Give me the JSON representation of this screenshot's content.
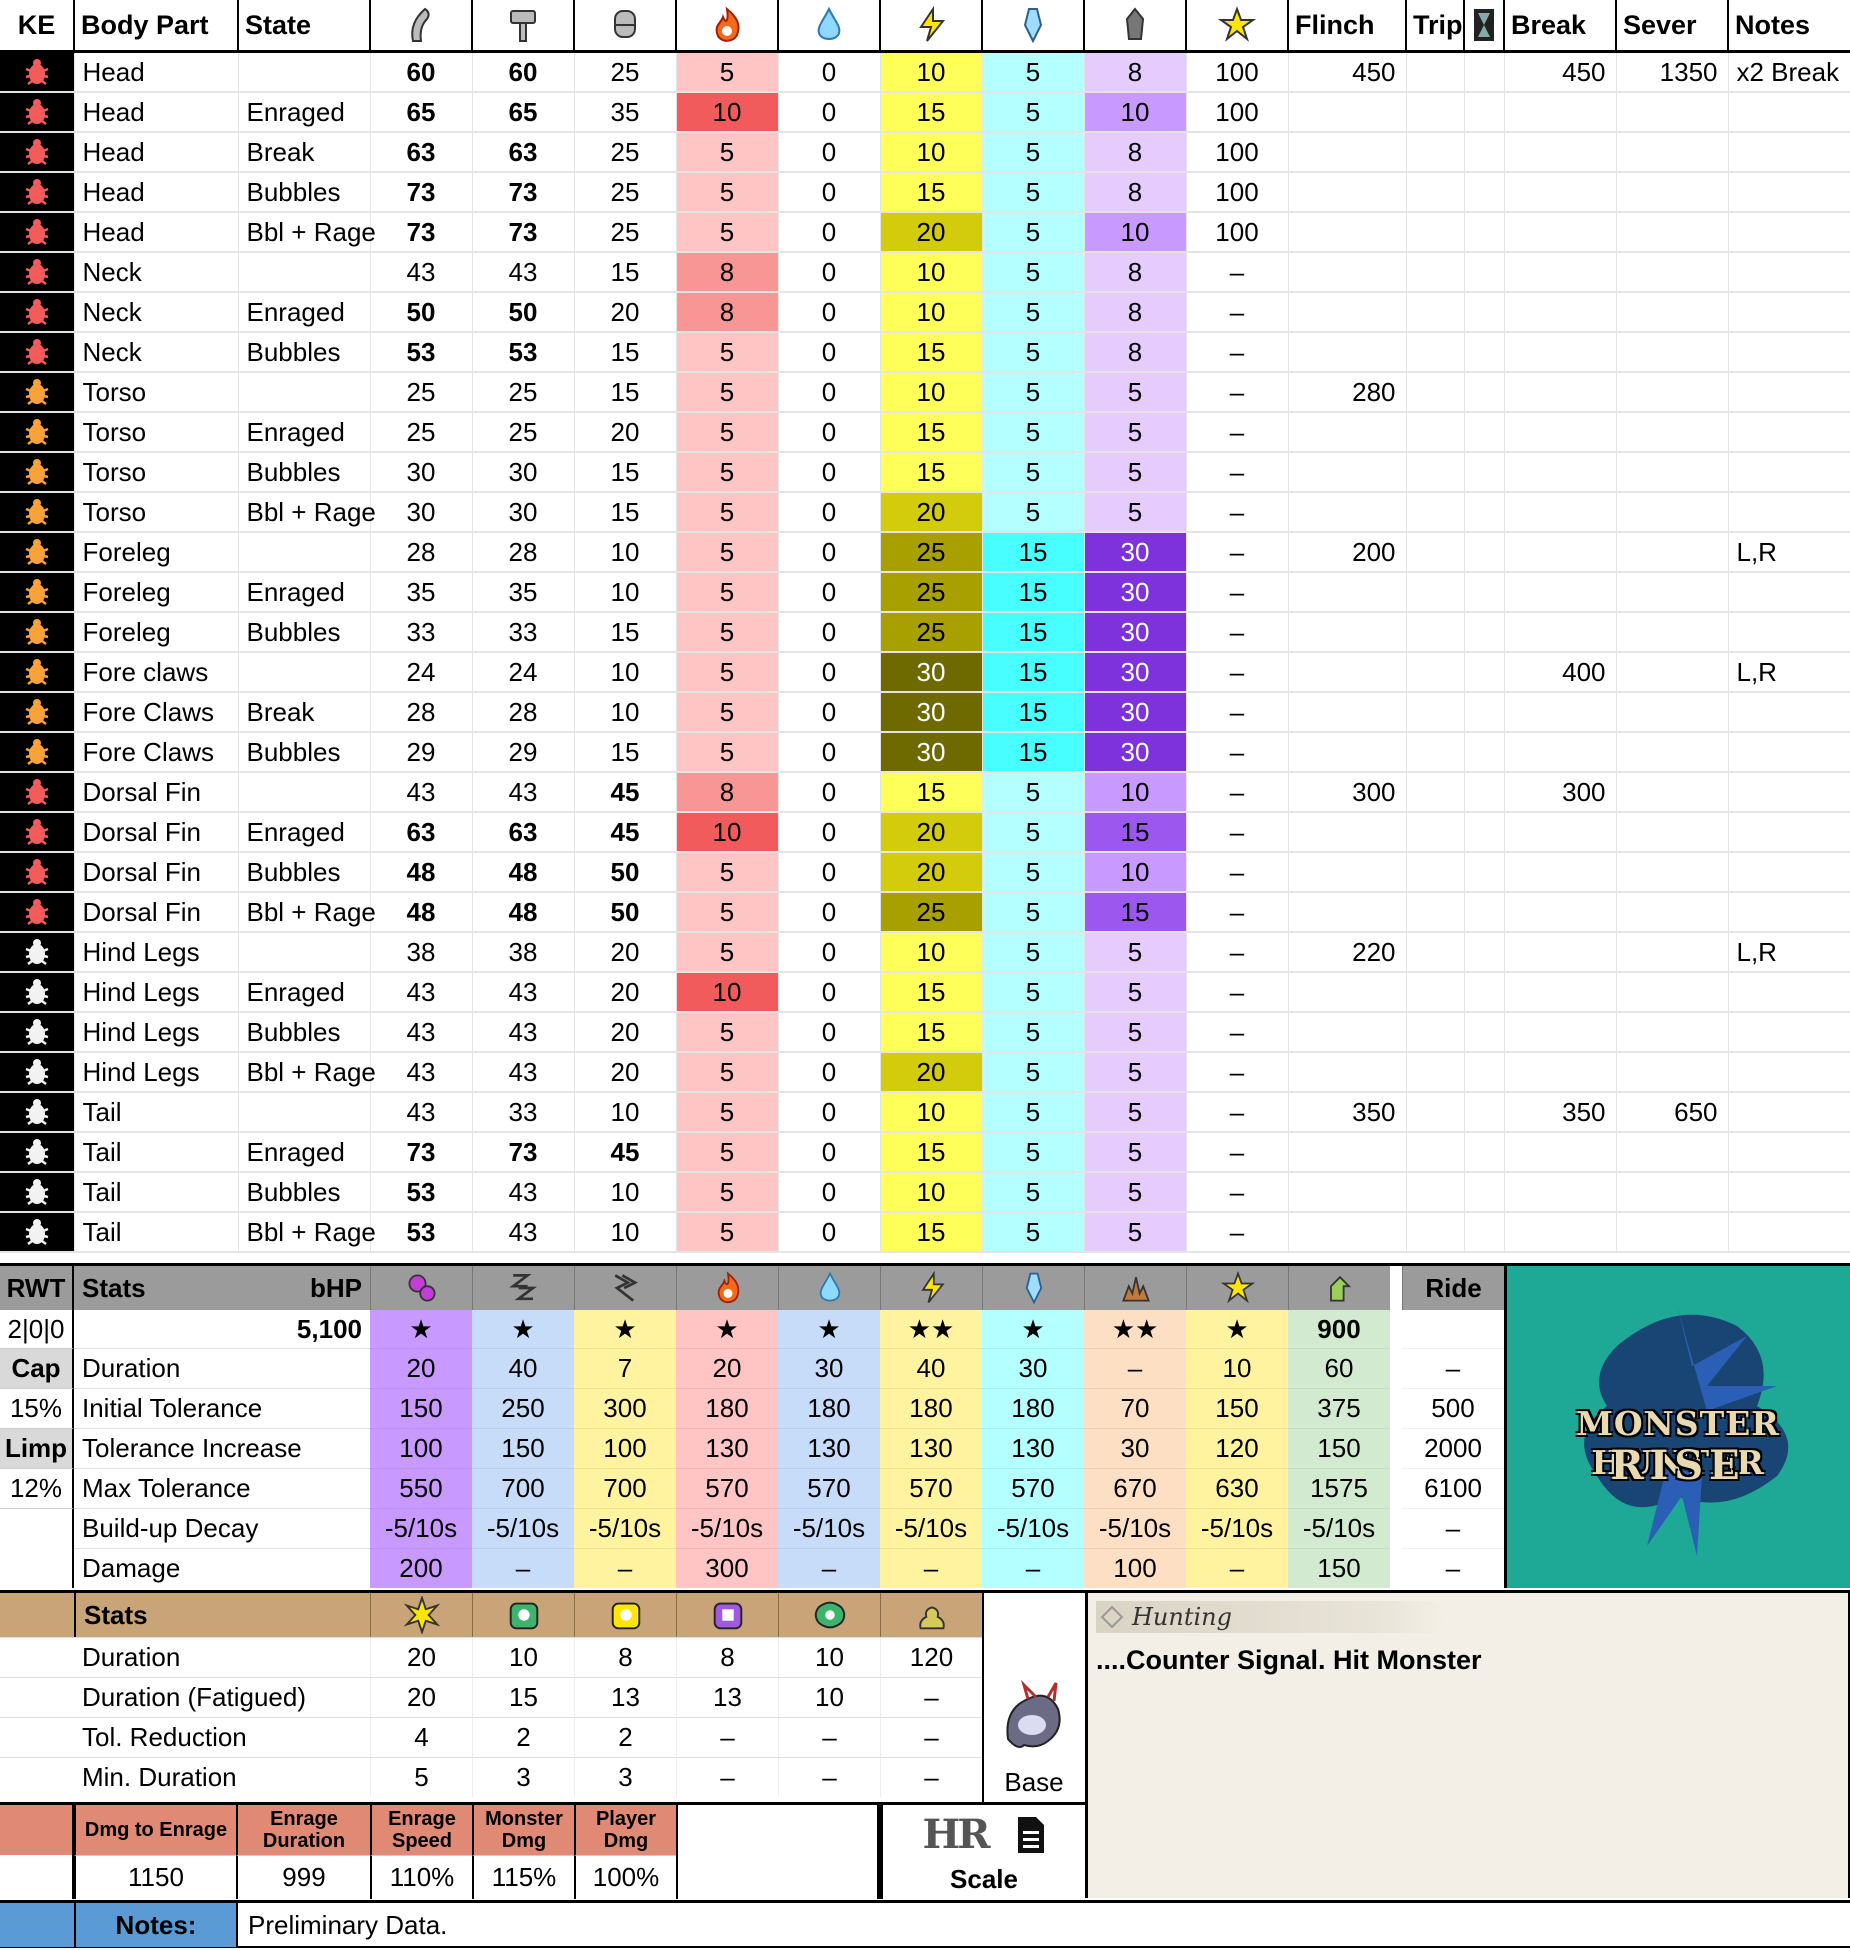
{
  "hitzone": {
    "headers": {
      "ke": "KE",
      "part": "Body Part",
      "state": "State",
      "flinch": "Flinch",
      "trip": "Trip",
      "break": "Break",
      "sever": "Sever",
      "notes": "Notes"
    },
    "icon_names": [
      "cut-icon",
      "blunt-icon",
      "shot-icon",
      "fire-icon",
      "water-icon",
      "thunder-icon",
      "ice-icon",
      "dragon-icon",
      "stun-icon"
    ],
    "rows": [
      {
        "ke": "red",
        "part": "Head",
        "state": "",
        "v": [
          60,
          60,
          25,
          5,
          0,
          10,
          5,
          8,
          "100"
        ],
        "bold": [
          1,
          1,
          0
        ],
        "flinch": "450",
        "trip": "",
        "break": "450",
        "sever": "1350",
        "notes": "x2 Break"
      },
      {
        "ke": "red",
        "part": "Head",
        "state": "Enraged",
        "v": [
          65,
          65,
          35,
          10,
          0,
          15,
          5,
          10,
          "100"
        ],
        "bold": [
          1,
          1,
          0
        ],
        "flinch": "",
        "trip": "",
        "break": "",
        "sever": "",
        "notes": ""
      },
      {
        "ke": "red",
        "part": "Head",
        "state": "Break",
        "v": [
          63,
          63,
          25,
          5,
          0,
          10,
          5,
          8,
          "100"
        ],
        "bold": [
          1,
          1,
          0
        ],
        "flinch": "",
        "trip": "",
        "break": "",
        "sever": "",
        "notes": ""
      },
      {
        "ke": "red",
        "part": "Head",
        "state": "Bubbles",
        "v": [
          73,
          73,
          25,
          5,
          0,
          15,
          5,
          8,
          "100"
        ],
        "bold": [
          1,
          1,
          0
        ],
        "flinch": "",
        "trip": "",
        "break": "",
        "sever": "",
        "notes": ""
      },
      {
        "ke": "red",
        "part": "Head",
        "state": "Bbl + Rage",
        "v": [
          73,
          73,
          25,
          5,
          0,
          20,
          5,
          10,
          "100"
        ],
        "bold": [
          1,
          1,
          0
        ],
        "flinch": "",
        "trip": "",
        "break": "",
        "sever": "",
        "notes": ""
      },
      {
        "ke": "red",
        "part": "Neck",
        "state": "",
        "v": [
          43,
          43,
          15,
          8,
          0,
          10,
          5,
          8,
          "–"
        ],
        "bold": [
          0,
          0,
          0
        ],
        "flinch": "",
        "trip": "",
        "break": "",
        "sever": "",
        "notes": ""
      },
      {
        "ke": "red",
        "part": "Neck",
        "state": "Enraged",
        "v": [
          50,
          50,
          20,
          8,
          0,
          10,
          5,
          8,
          "–"
        ],
        "bold": [
          1,
          1,
          0
        ],
        "flinch": "",
        "trip": "",
        "break": "",
        "sever": "",
        "notes": ""
      },
      {
        "ke": "red",
        "part": "Neck",
        "state": "Bubbles",
        "v": [
          53,
          53,
          15,
          5,
          0,
          15,
          5,
          8,
          "–"
        ],
        "bold": [
          1,
          1,
          0
        ],
        "flinch": "",
        "trip": "",
        "break": "",
        "sever": "",
        "notes": ""
      },
      {
        "ke": "orange",
        "part": "Torso",
        "state": "",
        "v": [
          25,
          25,
          15,
          5,
          0,
          10,
          5,
          5,
          "–"
        ],
        "bold": [
          0,
          0,
          0
        ],
        "flinch": "280",
        "trip": "",
        "break": "",
        "sever": "",
        "notes": ""
      },
      {
        "ke": "orange",
        "part": "Torso",
        "state": "Enraged",
        "v": [
          25,
          25,
          20,
          5,
          0,
          15,
          5,
          5,
          "–"
        ],
        "bold": [
          0,
          0,
          0
        ],
        "flinch": "",
        "trip": "",
        "break": "",
        "sever": "",
        "notes": ""
      },
      {
        "ke": "orange",
        "part": "Torso",
        "state": "Bubbles",
        "v": [
          30,
          30,
          15,
          5,
          0,
          15,
          5,
          5,
          "–"
        ],
        "bold": [
          0,
          0,
          0
        ],
        "flinch": "",
        "trip": "",
        "break": "",
        "sever": "",
        "notes": ""
      },
      {
        "ke": "orange",
        "part": "Torso",
        "state": "Bbl + Rage",
        "v": [
          30,
          30,
          15,
          5,
          0,
          20,
          5,
          5,
          "–"
        ],
        "bold": [
          0,
          0,
          0
        ],
        "flinch": "",
        "trip": "",
        "break": "",
        "sever": "",
        "notes": ""
      },
      {
        "ke": "orange",
        "part": "Foreleg",
        "state": "",
        "v": [
          28,
          28,
          10,
          5,
          0,
          25,
          15,
          30,
          "–"
        ],
        "bold": [
          0,
          0,
          0
        ],
        "flinch": "200",
        "trip": "",
        "break": "",
        "sever": "",
        "notes": "L,R"
      },
      {
        "ke": "orange",
        "part": "Foreleg",
        "state": "Enraged",
        "v": [
          35,
          35,
          10,
          5,
          0,
          25,
          15,
          30,
          "–"
        ],
        "bold": [
          0,
          0,
          0
        ],
        "flinch": "",
        "trip": "",
        "break": "",
        "sever": "",
        "notes": ""
      },
      {
        "ke": "orange",
        "part": "Foreleg",
        "state": "Bubbles",
        "v": [
          33,
          33,
          15,
          5,
          0,
          25,
          15,
          30,
          "–"
        ],
        "bold": [
          0,
          0,
          0
        ],
        "flinch": "",
        "trip": "",
        "break": "",
        "sever": "",
        "notes": ""
      },
      {
        "ke": "orange",
        "part": "Fore claws",
        "state": "",
        "v": [
          24,
          24,
          10,
          5,
          0,
          30,
          15,
          30,
          "–"
        ],
        "bold": [
          0,
          0,
          0
        ],
        "flinch": "",
        "trip": "",
        "break": "400",
        "sever": "",
        "notes": "L,R"
      },
      {
        "ke": "orange",
        "part": "Fore Claws",
        "state": "Break",
        "v": [
          28,
          28,
          10,
          5,
          0,
          30,
          15,
          30,
          "–"
        ],
        "bold": [
          0,
          0,
          0
        ],
        "flinch": "",
        "trip": "",
        "break": "",
        "sever": "",
        "notes": ""
      },
      {
        "ke": "orange",
        "part": "Fore Claws",
        "state": "Bubbles",
        "v": [
          29,
          29,
          15,
          5,
          0,
          30,
          15,
          30,
          "–"
        ],
        "bold": [
          0,
          0,
          0
        ],
        "flinch": "",
        "trip": "",
        "break": "",
        "sever": "",
        "notes": ""
      },
      {
        "ke": "red",
        "part": "Dorsal Fin",
        "state": "",
        "v": [
          43,
          43,
          45,
          8,
          0,
          15,
          5,
          10,
          "–"
        ],
        "bold": [
          0,
          0,
          1
        ],
        "flinch": "300",
        "trip": "",
        "break": "300",
        "sever": "",
        "notes": ""
      },
      {
        "ke": "red",
        "part": "Dorsal Fin",
        "state": "Enraged",
        "v": [
          63,
          63,
          45,
          10,
          0,
          20,
          5,
          15,
          "–"
        ],
        "bold": [
          1,
          1,
          1
        ],
        "flinch": "",
        "trip": "",
        "break": "",
        "sever": "",
        "notes": ""
      },
      {
        "ke": "red",
        "part": "Dorsal Fin",
        "state": "Bubbles",
        "v": [
          48,
          48,
          50,
          5,
          0,
          20,
          5,
          10,
          "–"
        ],
        "bold": [
          1,
          1,
          1
        ],
        "flinch": "",
        "trip": "",
        "break": "",
        "sever": "",
        "notes": ""
      },
      {
        "ke": "red",
        "part": "Dorsal Fin",
        "state": "Bbl + Rage",
        "v": [
          48,
          48,
          50,
          5,
          0,
          25,
          5,
          15,
          "–"
        ],
        "bold": [
          1,
          1,
          1
        ],
        "flinch": "",
        "trip": "",
        "break": "",
        "sever": "",
        "notes": ""
      },
      {
        "ke": "white",
        "part": "Hind Legs",
        "state": "",
        "v": [
          38,
          38,
          20,
          5,
          0,
          10,
          5,
          5,
          "–"
        ],
        "bold": [
          0,
          0,
          0
        ],
        "flinch": "220",
        "trip": "",
        "break": "",
        "sever": "",
        "notes": "L,R"
      },
      {
        "ke": "white",
        "part": "Hind Legs",
        "state": "Enraged",
        "v": [
          43,
          43,
          20,
          10,
          0,
          15,
          5,
          5,
          "–"
        ],
        "bold": [
          0,
          0,
          0
        ],
        "flinch": "",
        "trip": "",
        "break": "",
        "sever": "",
        "notes": ""
      },
      {
        "ke": "white",
        "part": "Hind Legs",
        "state": "Bubbles",
        "v": [
          43,
          43,
          20,
          5,
          0,
          15,
          5,
          5,
          "–"
        ],
        "bold": [
          0,
          0,
          0
        ],
        "flinch": "",
        "trip": "",
        "break": "",
        "sever": "",
        "notes": ""
      },
      {
        "ke": "white",
        "part": "Hind Legs",
        "state": "Bbl + Rage",
        "v": [
          43,
          43,
          20,
          5,
          0,
          20,
          5,
          5,
          "–"
        ],
        "bold": [
          0,
          0,
          0
        ],
        "flinch": "",
        "trip": "",
        "break": "",
        "sever": "",
        "notes": ""
      },
      {
        "ke": "white",
        "part": "Tail",
        "state": "",
        "v": [
          43,
          33,
          10,
          5,
          0,
          10,
          5,
          5,
          "–"
        ],
        "bold": [
          0,
          0,
          0
        ],
        "flinch": "350",
        "trip": "",
        "break": "350",
        "sever": "650",
        "notes": ""
      },
      {
        "ke": "white",
        "part": "Tail",
        "state": "Enraged",
        "v": [
          73,
          73,
          45,
          5,
          0,
          15,
          5,
          5,
          "–"
        ],
        "bold": [
          1,
          1,
          1
        ],
        "flinch": "",
        "trip": "",
        "break": "",
        "sever": "",
        "notes": ""
      },
      {
        "ke": "white",
        "part": "Tail",
        "state": "Bubbles",
        "v": [
          53,
          43,
          10,
          5,
          0,
          10,
          5,
          5,
          "–"
        ],
        "bold": [
          1,
          0,
          0
        ],
        "flinch": "",
        "trip": "",
        "break": "",
        "sever": "",
        "notes": ""
      },
      {
        "ke": "white",
        "part": "Tail",
        "state": "Bbl + Rage",
        "v": [
          53,
          43,
          10,
          5,
          0,
          15,
          5,
          5,
          "–"
        ],
        "bold": [
          1,
          0,
          0
        ],
        "flinch": "",
        "trip": "",
        "break": "",
        "sever": "",
        "notes": ""
      }
    ]
  },
  "status": {
    "rwt_label": "RWT",
    "stats_label": "Stats",
    "bhp_label": "bHP",
    "ride_label": "Ride",
    "rwt_value": "2|0|0",
    "bhp_value": "5,100",
    "cap_label": "Cap",
    "cap_value": "15%",
    "limp_label": "Limp",
    "limp_value": "12%",
    "icon_names": [
      "poison-icon",
      "sleep-icon",
      "paralysis-icon",
      "fireblight-icon",
      "waterblight-icon",
      "thunderblight-icon",
      "iceblight-icon",
      "blast-icon",
      "stun-icon",
      "exhaust-icon"
    ],
    "stars": [
      "★",
      "★",
      "★",
      "★",
      "★",
      "★★",
      "★",
      "★★",
      "★",
      "900",
      ""
    ],
    "row_labels": [
      "Duration",
      "Initial Tolerance",
      "Tolerance Increase",
      "Max Tolerance",
      "Build-up Decay",
      "Damage"
    ],
    "rows": [
      [
        "20",
        "40",
        "7",
        "20",
        "30",
        "40",
        "30",
        "–",
        "10",
        "60",
        "–"
      ],
      [
        "150",
        "250",
        "300",
        "180",
        "180",
        "180",
        "180",
        "70",
        "150",
        "375",
        "500"
      ],
      [
        "100",
        "150",
        "100",
        "130",
        "130",
        "130",
        "130",
        "30",
        "120",
        "150",
        "2000"
      ],
      [
        "550",
        "700",
        "700",
        "570",
        "570",
        "570",
        "570",
        "670",
        "630",
        "1575",
        "6100"
      ],
      [
        "-5/10s",
        "-5/10s",
        "-5/10s",
        "-5/10s",
        "-5/10s",
        "-5/10s",
        "-5/10s",
        "-5/10s",
        "-5/10s",
        "-5/10s",
        "–"
      ],
      [
        "200",
        "–",
        "–",
        "300",
        "–",
        "–",
        "–",
        "100",
        "–",
        "150",
        "–"
      ]
    ]
  },
  "logo": {
    "line1": "MONSTER HUNTER",
    "line2": "RISE"
  },
  "items": {
    "stats_label": "Stats",
    "icon_names": [
      "flash-icon",
      "shock-trap-icon",
      "pitfall-trap-icon",
      "sonic-trap-icon",
      "trap-icon",
      "dung-icon"
    ],
    "row_labels": [
      "Duration",
      "Duration (Fatigued)",
      "Tol. Reduction",
      "Min. Duration"
    ],
    "rows": [
      [
        "20",
        "10",
        "8",
        "8",
        "10",
        "120"
      ],
      [
        "20",
        "15",
        "13",
        "13",
        "10",
        "–"
      ],
      [
        "4",
        "2",
        "2",
        "–",
        "–",
        "–"
      ],
      [
        "5",
        "3",
        "3",
        "–",
        "–",
        "–"
      ]
    ],
    "base_label": "Base"
  },
  "hunting": {
    "tag": "Hunting",
    "text": "....Counter Signal. Hit Monster"
  },
  "enrage": {
    "headers": [
      "Dmg to Enrage",
      "Enrage Duration",
      "Enrage Speed",
      "Monster Dmg",
      "Player Dmg"
    ],
    "values": [
      "1150",
      "999",
      "110%",
      "115%",
      "100%"
    ]
  },
  "hr": {
    "label": "HR",
    "scale_label": "Scale"
  },
  "notes": {
    "label": "Notes:",
    "text": "Preliminary Data."
  },
  "colors": {
    "fire": [
      "#ffc4c4",
      "#f89696",
      "#f25b5b"
    ],
    "thunder": [
      "#ffff5a",
      "#d2cc0c",
      "#a8a000",
      "#6e6a00",
      "#4a4700"
    ],
    "ice": [
      "#b4ffff",
      "#48ffff"
    ],
    "dragon": [
      "#e6cbff",
      "#c899ff",
      "#9b57ee",
      "#7d32dc"
    ],
    "teal": "#1ea896",
    "orange_header": "#e08a76",
    "tan_header": "#c8a478",
    "blue_notes": "#5b9bd5"
  }
}
